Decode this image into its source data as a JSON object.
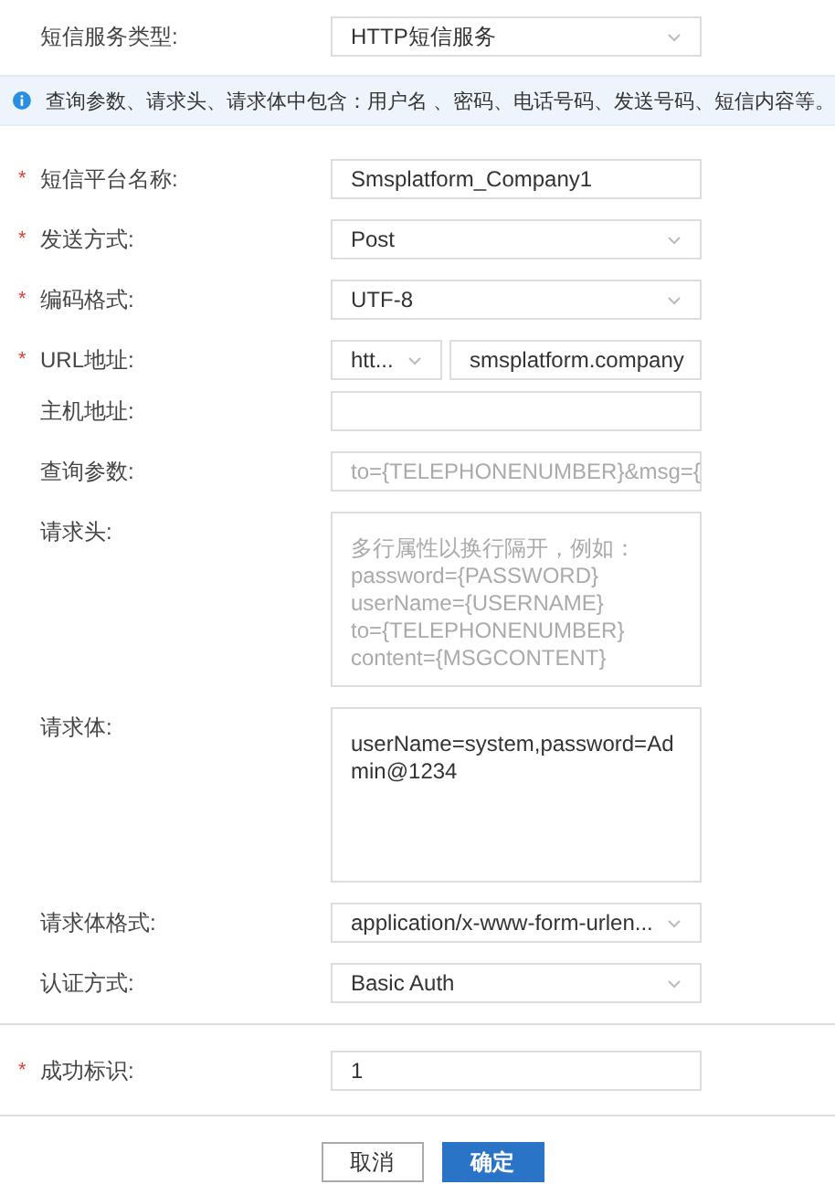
{
  "service_type": {
    "label": "短信服务类型:",
    "kind": "select",
    "value": "HTTP短信服务"
  },
  "notice": "查询参数、请求头、请求体中包含：用户名 、密码、电话号码、发送号码、短信内容等。",
  "fields": [
    {
      "label": "短信平台名称:",
      "required_mark": "*",
      "kind": "text",
      "value": "Smsplatform_Company1"
    },
    {
      "label": "发送方式:",
      "required_mark": "*",
      "kind": "select",
      "value": "Post"
    },
    {
      "label": "编码格式:",
      "required_mark": "*",
      "kind": "select",
      "value": "UTF-8"
    },
    {
      "label": "URL地址:",
      "required_mark": "*",
      "kind": "url",
      "protocol": "htt...",
      "value": "smsplatform.company"
    },
    {
      "label": "主机地址:",
      "kind": "text"
    },
    {
      "label": "查询参数:",
      "kind": "text",
      "placeholder": "to={TELEPHONENUMBER}&msg={"
    },
    {
      "label": "请求头:",
      "kind": "textarea",
      "placeholder": "多行属性以换行隔开，例如：\npassword={PASSWORD}\nuserName={USERNAME}\nto={TELEPHONENUMBER}\ncontent={MSGCONTENT}"
    },
    {
      "label": "请求体:",
      "kind": "textarea",
      "value": "userName=system,password=Admin@1234"
    },
    {
      "label": "请求体格式:",
      "kind": "select",
      "value": "application/x-www-form-urlen..."
    },
    {
      "label": "认证方式:",
      "kind": "select",
      "value": "Basic Auth"
    }
  ],
  "success": {
    "label": "成功标识:",
    "required_mark": "*",
    "kind": "text",
    "value": "1"
  },
  "buttons": [
    {
      "label": "取消",
      "primary": false
    },
    {
      "label": "确定",
      "primary": true
    }
  ]
}
